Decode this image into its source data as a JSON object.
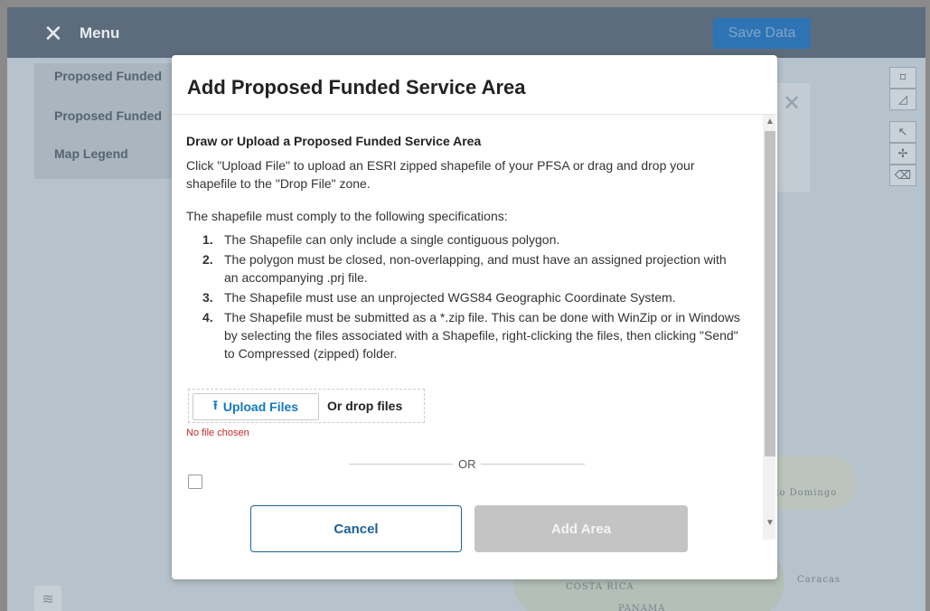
{
  "header": {
    "menu_label": "Menu",
    "close_icon": "close-icon",
    "save_label": "Save Data"
  },
  "side_panel": {
    "items": [
      {
        "label": "Proposed Funded"
      },
      {
        "label": "Proposed Funded"
      },
      {
        "label": "Map Legend"
      }
    ]
  },
  "map": {
    "labels": {
      "santo_domingo": "nto Domingo",
      "caracas": "Caracas",
      "costa_rica": "COSTA RICA",
      "panama": "PANAMA"
    },
    "tools": [
      "polygon-icon",
      "draw-icon",
      "pointer-icon",
      "move-icon",
      "eraser-icon"
    ]
  },
  "modal": {
    "title": "Add Proposed Funded Service Area",
    "section_title": "Draw or Upload a Proposed Funded Service Area",
    "intro": "Click \"Upload File\" to upload an ESRI zipped shapefile of your PFSA or drag and drop your shapefile to the \"Drop File\" zone.",
    "spec_intro": "The shapefile must comply to the following specifications:",
    "specs": [
      {
        "num": "1.",
        "text": "The Shapefile can only include a single contiguous polygon."
      },
      {
        "num": "2.",
        "text": "The polygon must be closed, non-overlapping, and must have an assigned projection with an accompanying .prj file."
      },
      {
        "num": "3.",
        "text": "The Shapefile must use an unprojected WGS84 Geographic Coordinate System."
      },
      {
        "num": "4.",
        "text": "The Shapefile must be submitted as a *.zip file. This can be done with WinZip or in Windows by selecting the files associated with a Shapefile, right-clicking the files, then clicking \"Send\" to Compressed (zipped) folder."
      }
    ],
    "upload_label": "Upload Files",
    "drop_label": "Or drop files",
    "no_file": "No file chosen",
    "or_label": "OR",
    "cancel_label": "Cancel",
    "add_label": "Add Area"
  }
}
